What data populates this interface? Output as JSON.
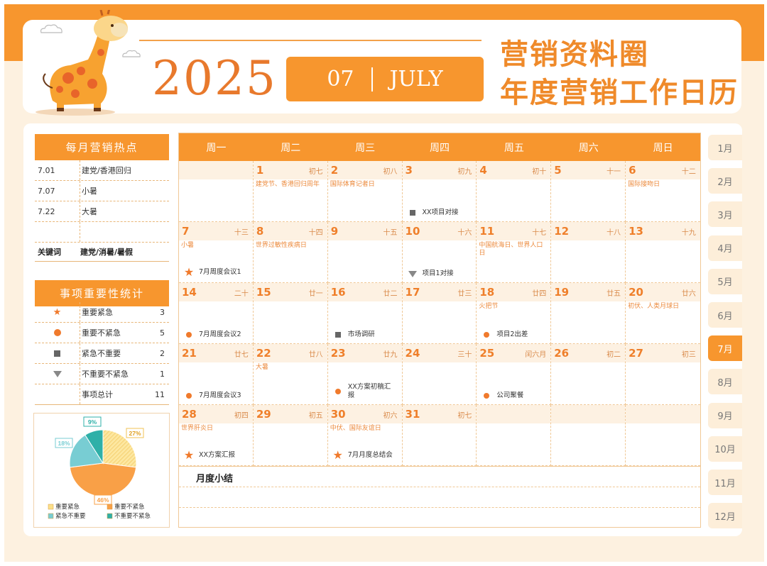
{
  "header": {
    "year": "2025",
    "month_num": "07",
    "month_en": "JULY",
    "title_line1": "营销资料圈",
    "title_line2": "年度营销工作日历"
  },
  "hotspots": {
    "title": "每月营销热点",
    "items": [
      {
        "date": "7.01",
        "event": "建党/香港回归"
      },
      {
        "date": "7.07",
        "event": "小暑"
      },
      {
        "date": "7.22",
        "event": "大暑"
      },
      {
        "date": "",
        "event": ""
      }
    ],
    "keyword_label": "关键词",
    "keywords": "建党/消暑/暑假"
  },
  "stats": {
    "title": "事项重要性统计",
    "rows": [
      {
        "label": "重要紧急",
        "count": "3"
      },
      {
        "label": "重要不紧急",
        "count": "5"
      },
      {
        "label": "紧急不重要",
        "count": "2"
      },
      {
        "label": "不重要不紧急",
        "count": "1"
      },
      {
        "label": "事项总计",
        "count": "11"
      }
    ]
  },
  "pie": {
    "slices": [
      {
        "label": "重要紧急",
        "pct": "27%",
        "value": 27,
        "color": "#fbe08a"
      },
      {
        "label": "重要不紧急",
        "pct": "46%",
        "value": 46,
        "color": "#f9a047"
      },
      {
        "label": "紧急不重要",
        "pct": "18%",
        "value": 18,
        "color": "#78cdd3"
      },
      {
        "label": "不重要不紧急",
        "pct": "9%",
        "value": 9,
        "color": "#2fb0a8"
      }
    ]
  },
  "calendar": {
    "weekdays": [
      "周一",
      "周二",
      "周三",
      "周四",
      "周五",
      "周六",
      "周日"
    ],
    "weeks": [
      [
        {
          "n": "",
          "l": "",
          "f": "",
          "e": "",
          "m": ""
        },
        {
          "n": "1",
          "l": "初七",
          "f": "建党节、香港回归周年",
          "e": "",
          "m": ""
        },
        {
          "n": "2",
          "l": "初八",
          "f": "国际体育记者日",
          "e": "",
          "m": ""
        },
        {
          "n": "3",
          "l": "初九",
          "f": "",
          "e": "XX项目对接",
          "m": "square"
        },
        {
          "n": "4",
          "l": "初十",
          "f": "",
          "e": "",
          "m": ""
        },
        {
          "n": "5",
          "l": "十一",
          "f": "",
          "e": "",
          "m": ""
        },
        {
          "n": "6",
          "l": "十二",
          "f": "国际接吻日",
          "e": "",
          "m": ""
        }
      ],
      [
        {
          "n": "7",
          "l": "十三",
          "f": "小暑",
          "e": "7月周度会议1",
          "m": "star"
        },
        {
          "n": "8",
          "l": "十四",
          "f": "世界过敏性疾病日",
          "e": "",
          "m": ""
        },
        {
          "n": "9",
          "l": "十五",
          "f": "",
          "e": "",
          "m": ""
        },
        {
          "n": "10",
          "l": "十六",
          "f": "",
          "e": "项目1对接",
          "m": "triangle"
        },
        {
          "n": "11",
          "l": "十七",
          "f": "中国航海日、世界人口日",
          "e": "",
          "m": ""
        },
        {
          "n": "12",
          "l": "十八",
          "f": "",
          "e": "",
          "m": ""
        },
        {
          "n": "13",
          "l": "十九",
          "f": "",
          "e": "",
          "m": ""
        }
      ],
      [
        {
          "n": "14",
          "l": "二十",
          "f": "",
          "e": "7月周度会议2",
          "m": "dot"
        },
        {
          "n": "15",
          "l": "廿一",
          "f": "",
          "e": "",
          "m": ""
        },
        {
          "n": "16",
          "l": "廿二",
          "f": "",
          "e": "市场调研",
          "m": "square"
        },
        {
          "n": "17",
          "l": "廿三",
          "f": "",
          "e": "",
          "m": ""
        },
        {
          "n": "18",
          "l": "廿四",
          "f": "火把节",
          "e": "项目2出差",
          "m": "dot"
        },
        {
          "n": "19",
          "l": "廿五",
          "f": "",
          "e": "",
          "m": ""
        },
        {
          "n": "20",
          "l": "廿六",
          "f": "初伏、人类月球日",
          "e": "",
          "m": ""
        }
      ],
      [
        {
          "n": "21",
          "l": "廿七",
          "f": "",
          "e": "7月周度会议3",
          "m": "dot"
        },
        {
          "n": "22",
          "l": "廿八",
          "f": "大暑",
          "e": "",
          "m": ""
        },
        {
          "n": "23",
          "l": "廿九",
          "f": "",
          "e": "XX方案初稿汇报",
          "m": "dot"
        },
        {
          "n": "24",
          "l": "三十",
          "f": "",
          "e": "",
          "m": ""
        },
        {
          "n": "25",
          "l": "闰六月",
          "f": "",
          "e": "公司聚餐",
          "m": "dot"
        },
        {
          "n": "26",
          "l": "初二",
          "f": "",
          "e": "",
          "m": ""
        },
        {
          "n": "27",
          "l": "初三",
          "f": "",
          "e": "",
          "m": ""
        }
      ],
      [
        {
          "n": "28",
          "l": "初四",
          "f": "世界肝炎日",
          "e": "XX方案汇报",
          "m": "star"
        },
        {
          "n": "29",
          "l": "初五",
          "f": "",
          "e": "",
          "m": ""
        },
        {
          "n": "30",
          "l": "初六",
          "f": "中伏、国际友谊日",
          "e": "7月月度总结会",
          "m": "star"
        },
        {
          "n": "31",
          "l": "初七",
          "f": "",
          "e": "",
          "m": ""
        },
        {
          "n": "",
          "l": "",
          "f": "",
          "e": "",
          "m": ""
        },
        {
          "n": "",
          "l": "",
          "f": "",
          "e": "",
          "m": ""
        },
        {
          "n": "",
          "l": "",
          "f": "",
          "e": "",
          "m": ""
        }
      ]
    ],
    "summary_title": "月度小结"
  },
  "month_tabs": [
    "1月",
    "2月",
    "3月",
    "4月",
    "5月",
    "6月",
    "7月",
    "8月",
    "9月",
    "10月",
    "11月",
    "12月"
  ],
  "active_month": "7月",
  "colors": {
    "accent": "#f7962e",
    "text_orange": "#ef7f2a",
    "bg": "#fdf1e0"
  }
}
